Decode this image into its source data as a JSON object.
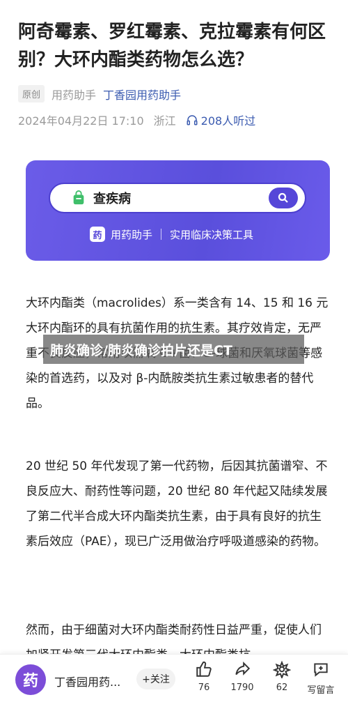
{
  "article": {
    "title": "阿奇霉素、罗红霉素、克拉霉素有何区别？大环内酯类药物怎么选？",
    "original_tag": "原创",
    "author_primary": "用药助手",
    "author_secondary": "丁香园用药助手",
    "datetime": "2024年04月22日 17:10",
    "location": "浙江",
    "listeners": "208人听过"
  },
  "banner": {
    "search_text": "查疾病",
    "badge": "药",
    "app_name": "用药助手",
    "tagline": "实用临床决策工具"
  },
  "overlay": {
    "text": "肺炎确诊/肺炎确诊拍片还是CT"
  },
  "paragraphs": [
    "大环内酯类（macrolides）系一类含有 14、15 和 16 元大环内酯环的具有抗菌作用的抗生素。其疗效肯定，无严重不良反应，常用以需氧 G+菌、G-球菌和厌氧球菌等感染的首选药，以及对 β-内酰胺类抗生素过敏患者的替代品。",
    "20 世纪 50 年代发现了第一代药物，后因其抗菌谱窄、不良反应大、耐药性等问题，20 世纪 80 年代起又陆续发展了第二代半合成大环内酯类抗生素，由于具有良好的抗生素后效应（PAE），现已广泛用做治疗呼吸道感染的药物。",
    "然而，由于细菌对大环内酯类耐药性日益严重，促使人们加紧开发第三代大环内酯类，大环内酯类抗"
  ],
  "bottombar": {
    "avatar_char": "药",
    "account_name": "丁香园用药...",
    "follow": "+关注",
    "likes": "76",
    "shares": "1790",
    "recommends": "62",
    "comment_label": "写留言"
  },
  "colors": {
    "banner": "#5a4fdc",
    "accent_blue": "#3b5bb0"
  }
}
